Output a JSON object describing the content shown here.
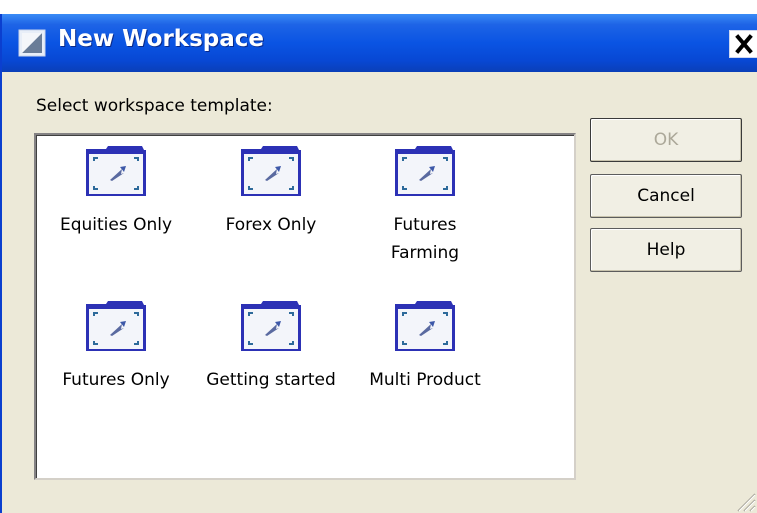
{
  "window": {
    "title": "New Workspace",
    "close_glyph": "×"
  },
  "dialog": {
    "prompt": "Select workspace template:"
  },
  "templates": [
    {
      "label_line1": "Equities Only",
      "label_line2": "",
      "icon": "folder-chart-icon"
    },
    {
      "label_line1": "Forex Only",
      "label_line2": "",
      "icon": "folder-chart-icon"
    },
    {
      "label_line1": "Futures",
      "label_line2": "Farming",
      "icon": "folder-chart-icon"
    },
    {
      "label_line1": "Futures Only",
      "label_line2": "",
      "icon": "folder-chart-icon"
    },
    {
      "label_line1": "Getting started",
      "label_line2": "",
      "icon": "folder-chart-icon"
    },
    {
      "label_line1": "Multi Product",
      "label_line2": "",
      "icon": "folder-chart-icon"
    }
  ],
  "buttons": {
    "ok": "OK",
    "cancel": "Cancel",
    "help": "Help"
  },
  "colors": {
    "titlebar": "#0a54e3",
    "dialog_bg": "#ece9d8",
    "folder": "#2c31b5"
  }
}
